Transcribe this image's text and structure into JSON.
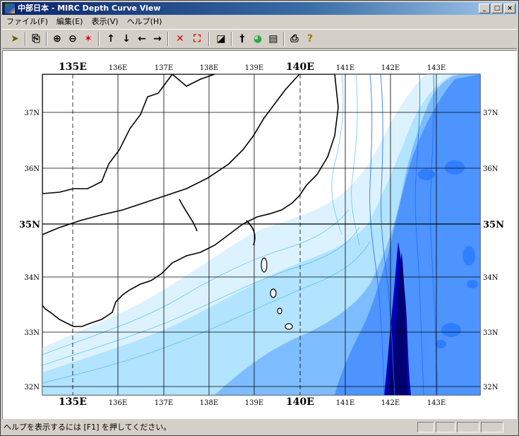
{
  "window": {
    "title": "中部日本 - MIRC Depth Curve View",
    "buttons": {
      "minimize": "_",
      "maximize": "□",
      "close": "×"
    }
  },
  "menu": {
    "file": "ファイル(F)",
    "edit": "編集(E)",
    "view": "表示(V)",
    "help": "ヘルプ(H)"
  },
  "toolbar": {
    "icons": [
      "pointer-icon",
      "copy-icon",
      "zoom-in-icon",
      "zoom-out-icon",
      "zoom-all-icon",
      "arrow-up-icon",
      "arrow-down-icon",
      "arrow-left-icon",
      "arrow-right-icon",
      "fit-x-icon",
      "fit-box-icon",
      "contrast-icon",
      "cursor-icon",
      "color-icon",
      "legend-icon",
      "print-icon",
      "help-icon"
    ]
  },
  "map": {
    "top_lon_labels": [
      "135E",
      "136E",
      "137E",
      "138E",
      "139E",
      "140E",
      "141E",
      "142E",
      "143E"
    ],
    "bottom_lon_labels": [
      "135E",
      "136E",
      "137E",
      "138E",
      "139E",
      "140E",
      "141E",
      "142E",
      "143E"
    ],
    "left_lat_labels": [
      "37N",
      "36N",
      "35N",
      "34N",
      "33N",
      "32N"
    ],
    "right_lat_labels": [
      "37N",
      "36N",
      "35N",
      "34N",
      "33N",
      "32N"
    ],
    "colors": {
      "deep": "#0000b8",
      "mid": "#1e6bff",
      "shallow": "#7fd0ff",
      "land_line": "#000000"
    }
  },
  "status": {
    "text": "ヘルプを表示するには [F1] を押してください。"
  }
}
